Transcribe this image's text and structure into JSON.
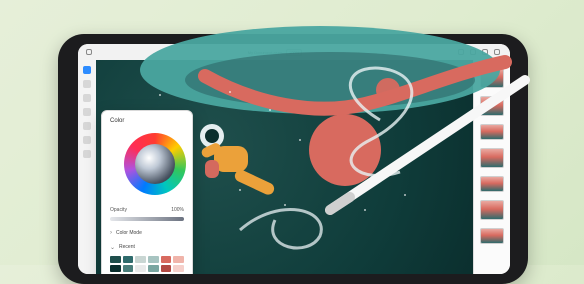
{
  "app": {
    "document_title": "My Document.aspx",
    "document_badge": "100%"
  },
  "color_panel": {
    "title": "Color",
    "opacity_label": "Opacity",
    "opacity_value": "100%",
    "section_1": "Color Mode",
    "section_2": "Recent",
    "swatches": [
      "#1f4f4c",
      "#2f6b6c",
      "#c9d6d3",
      "#a7c4c1",
      "#d86a5f",
      "#f0b4aa",
      "#0b2f2e",
      "#4a7e7b",
      "#e9eaea",
      "#7aa6a1",
      "#b24a44",
      "#f5d0cb"
    ]
  },
  "colors": {
    "page_bg": "#dfeccf",
    "tablet_frame": "#1c1c1e",
    "canvas_space": "#0f3c3a",
    "planet_teal": "#4aa6a0",
    "planet_coral": "#d86a5f",
    "astronaut_orange": "#f0a33a",
    "stroke_white": "#e9f2f4"
  },
  "icons": {
    "toolbar": [
      "brush-icon",
      "eraser-icon",
      "layers-icon",
      "color-icon",
      "settings-icon"
    ],
    "top_right": [
      "share-icon",
      "undo-icon",
      "redo-icon",
      "cloud-icon"
    ]
  }
}
